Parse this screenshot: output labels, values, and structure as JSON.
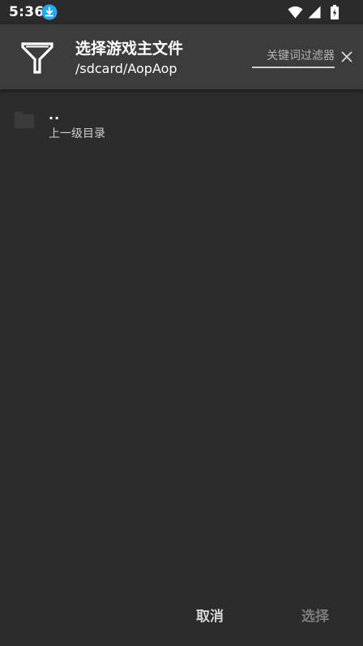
{
  "status_bar": {
    "time": "5:36",
    "icons": [
      "download-icon",
      "wifi-icon",
      "signal-icon",
      "battery-icon"
    ]
  },
  "header": {
    "icon": "filter-icon",
    "title": "选择游戏主文件",
    "path": "/sdcard/AopAop",
    "filter_placeholder": "关键词过滤器",
    "filter_value": "",
    "clear_icon": "close-icon"
  },
  "files": [
    {
      "icon": "folder-icon",
      "name": "..",
      "description": "上一级目录"
    }
  ],
  "actions": {
    "cancel_label": "取消",
    "select_label": "选择"
  },
  "colors": {
    "background": "#2c2c2c",
    "header": "#3c3c3c",
    "accent_download": "#29a8f0",
    "disabled_text": "#7c7c7c"
  }
}
